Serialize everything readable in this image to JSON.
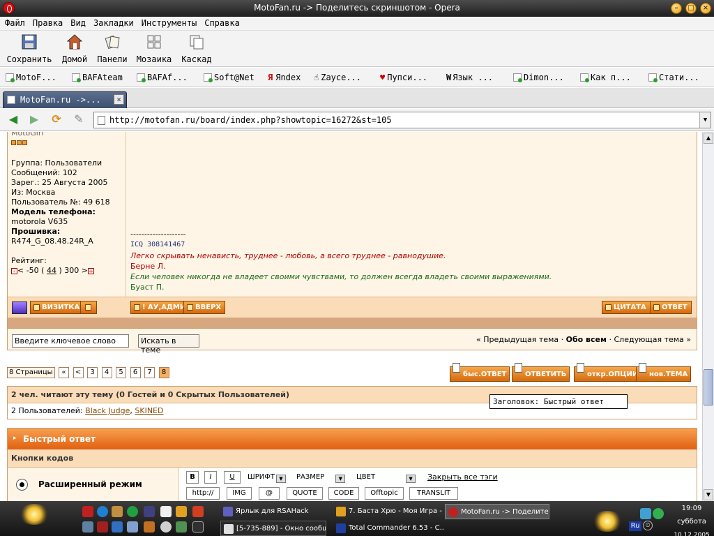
{
  "window": {
    "title": "MotoFan.ru -> Поделитесь скриншотом - Opera"
  },
  "menu": [
    "Файл",
    "Правка",
    "Вид",
    "Закладки",
    "Инструменты",
    "Справка"
  ],
  "toolbar": {
    "save": "Сохранить",
    "home": "Домой",
    "panels": "Панели",
    "mosaic": "Мозаика",
    "cascade": "Каскад"
  },
  "bookmarks": [
    "MotoF...",
    "BAFAteam",
    "BAFAf...",
    "Soft@Net",
    "Яndex",
    "Zayce...",
    "Пупси...",
    "Язык ...",
    "Dimon...",
    "Как п...",
    "Стати..."
  ],
  "tab": {
    "label": "MotoFan.ru ->..."
  },
  "address": {
    "url": "http://motofan.ru/board/index.php?showtopic=16272&st=105"
  },
  "profile": {
    "name_cut": "MotoGirl",
    "group": "Группа: Пользователи",
    "messages": "Сообщений: 102",
    "registered": "Зарег.: 25 Августа 2005",
    "from": "Из: Москва",
    "user_no": "Пользователь №: 49 618",
    "phone_label": "Модель телефона:",
    "phone": "motorola V635",
    "firmware_label": "Прошивка:",
    "firmware": "R474_G_08.48.24R_A",
    "rating_label": "Рейтинг:",
    "rating_pre": "< -50 (",
    "rating_value": "44",
    "rating_post": ") 300 >"
  },
  "signature": {
    "divider": "--------------------",
    "icq": "ICQ 308141467",
    "quote1": "Легко скрывать ненависть, труднее - любовь, а всего труднее - равнодушие.",
    "author1": "Берне Л.",
    "quote2": "Если человек никогда не владеет своими чувствами, то должен всегда владеть своими выражениями.",
    "author2": "Буаст П."
  },
  "post_buttons": {
    "card": "ВИЗИТКА",
    "admin": "! АУ,АДМИН",
    "top": "ВВЕРХ",
    "quote": "ЦИТАТА",
    "reply": "ОТВЕТ"
  },
  "search": {
    "placeholder": "Введите ключевое слово",
    "button": "Искать в теме"
  },
  "topic_nav": {
    "prev": "« Предыдущая тема",
    "all": "Обо всем",
    "next": "Следующая тема »"
  },
  "pagination": {
    "label": "8 Страницы",
    "first": "«",
    "prev": "<",
    "pages": [
      "3",
      "4",
      "5",
      "6",
      "7",
      "8"
    ],
    "current": "8"
  },
  "reply_buttons": {
    "fast": "быс.ОТВЕТ",
    "reply": "ОТВЕТИТЬ",
    "options": "откр.ОПЦИИ",
    "new": "нов.ТЕМА"
  },
  "readers": {
    "header": "2 чел. читают эту тему (0 Гостей и 0 Скрытых Пользователей)",
    "prefix": "2 Пользователей:",
    "user1": "Black Judge",
    "sep": ",",
    "user2": "SKINED"
  },
  "tooltip": "Заголовок: Быстрый ответ",
  "quick_reply": {
    "title": "Быстрый ответ",
    "codes": "Кнопки кодов",
    "mode": "Расширенный режим",
    "bold": "B",
    "italic": "I",
    "underline": "U",
    "font": "ШРИФТ",
    "size": "РАЗМЕР",
    "color": "ЦВЕТ",
    "close_tags": "Закрыть все тэги",
    "tags": [
      "http://",
      "IMG",
      "@",
      "QUOTE",
      "CODE",
      "Offtopic",
      "TRANSLIT"
    ]
  },
  "taskbar": {
    "tasks": [
      "Ярлык для RSAHack",
      "7. Баста Хрю - Моя Игра - ...",
      "MotoFan.ru -> Поделитес...",
      "[5-735-889] - Окно сообщ...",
      "Total Commander 6.53 - С..."
    ],
    "lang": "Ru",
    "time": "19:09",
    "day": "суббота",
    "date": "10.12.2005"
  }
}
